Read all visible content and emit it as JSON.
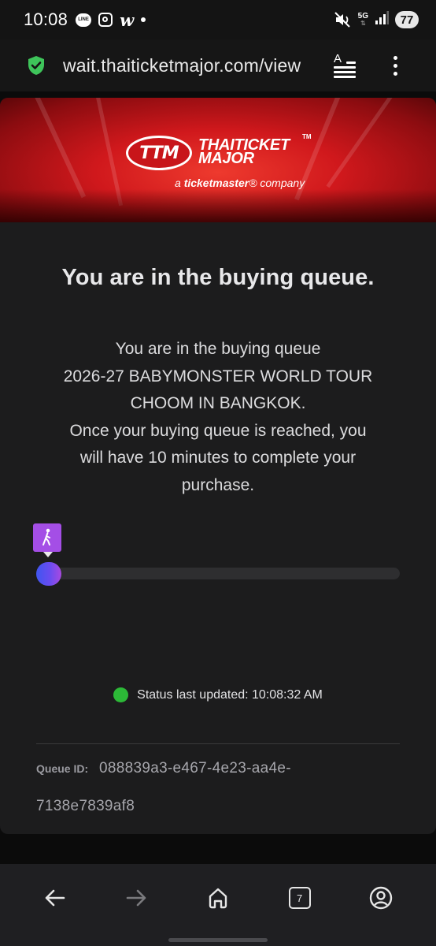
{
  "status_bar": {
    "time": "10:08",
    "line_label": "LINE",
    "w_label": "w",
    "network": "5G",
    "battery": "77"
  },
  "browser": {
    "url": "wait.thaiticketmajor.com/view",
    "tab_count": "7"
  },
  "banner": {
    "logo_text": "TTM",
    "brand_line1": "THAITICKET",
    "brand_line2": "MAJOR",
    "brand_tm": "TM",
    "tagline_prefix": "a ",
    "tagline_brand": "ticketmaster",
    "tagline_suffix": "® company",
    "accent_color": "#d0181c"
  },
  "queue": {
    "title": "You are in the buying queue.",
    "message_lines": [
      "You are in the buying queue",
      "2026-27 BABYMONSTER WORLD TOUR",
      "CHOOM IN BANGKOK.",
      "Once your buying queue is reached, you",
      "will have 10 minutes to complete your",
      "purchase."
    ],
    "progress_fraction": 0.0,
    "status_text": "Status last updated: 10:08:32 AM",
    "status_color": "#2cb937",
    "queue_id_label": "Queue ID:",
    "queue_id_line1": "088839a3-e467-4e23-aa4e-",
    "queue_id_line2": "7138e7839af8"
  }
}
